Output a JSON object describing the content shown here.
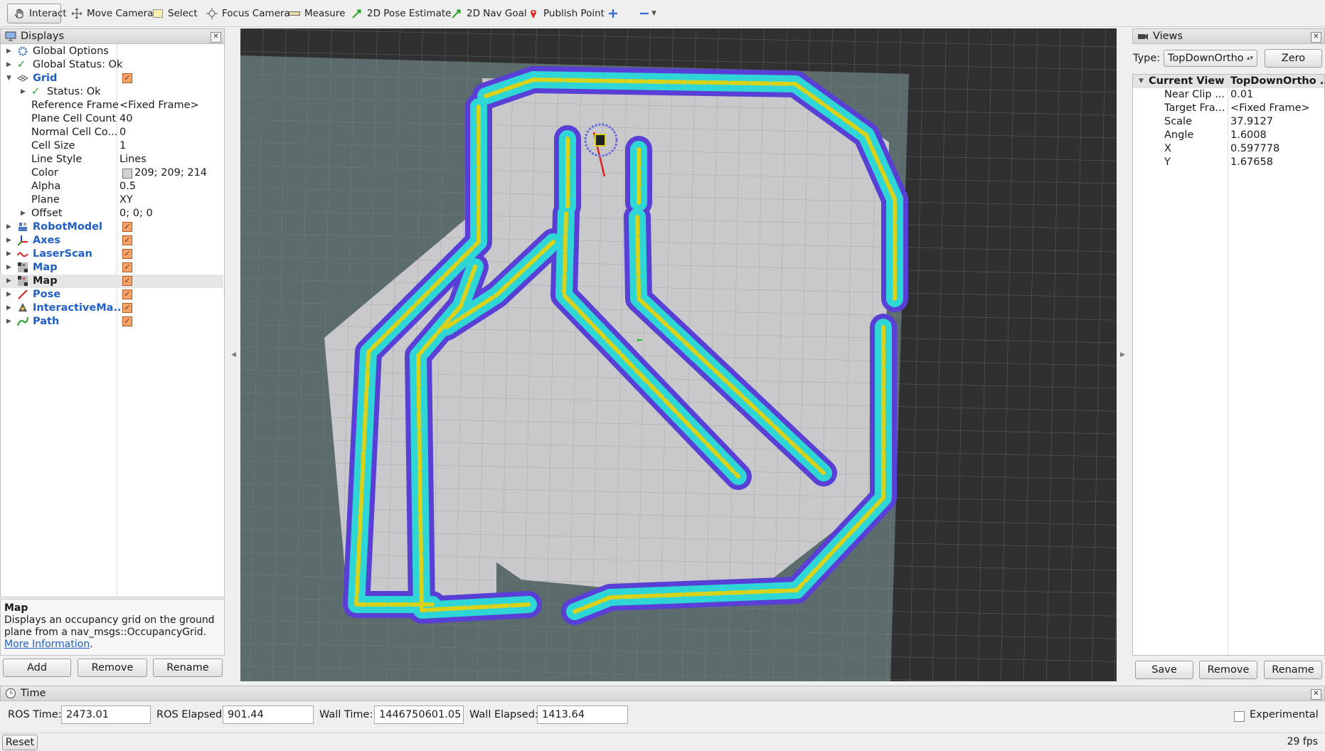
{
  "toolbar": {
    "interact": "Interact",
    "move_camera": "Move Camera",
    "select": "Select",
    "focus_camera": "Focus Camera",
    "measure": "Measure",
    "pose_estimate": "2D Pose Estimate",
    "nav_goal": "2D Nav Goal",
    "publish_point": "Publish Point"
  },
  "displays": {
    "title": "Displays",
    "rows": [
      {
        "name": "Global Options"
      },
      {
        "name": "Global Status: Ok"
      },
      {
        "name": "Grid"
      },
      {
        "name": "Status: Ok"
      },
      {
        "name": "Reference Frame",
        "value": "<Fixed Frame>"
      },
      {
        "name": "Plane Cell Count",
        "value": "40"
      },
      {
        "name": "Normal Cell Co...",
        "value": "0"
      },
      {
        "name": "Cell Size",
        "value": "1"
      },
      {
        "name": "Line Style",
        "value": "Lines"
      },
      {
        "name": "Color",
        "value": "209; 209; 214"
      },
      {
        "name": "Alpha",
        "value": "0.5"
      },
      {
        "name": "Plane",
        "value": "XY"
      },
      {
        "name": "Offset",
        "value": "0; 0; 0"
      },
      {
        "name": "RobotModel"
      },
      {
        "name": "Axes"
      },
      {
        "name": "LaserScan"
      },
      {
        "name": "Map"
      },
      {
        "name": "Map"
      },
      {
        "name": "Pose"
      },
      {
        "name": "InteractiveMa..."
      },
      {
        "name": "Path"
      }
    ],
    "desc_title": "Map",
    "desc_text": "Displays an occupancy grid on the ground plane from a nav_msgs::OccupancyGrid. ",
    "desc_link": "More Information",
    "desc_end": ".",
    "add": "Add",
    "remove": "Remove",
    "rename": "Rename"
  },
  "views": {
    "title": "Views",
    "type_label": "Type:",
    "type_value": "TopDownOrtho",
    "zero": "Zero",
    "header_name": "Current View",
    "header_value": "TopDownOrtho ...",
    "props": [
      {
        "name": "Near Clip ...",
        "value": "0.01"
      },
      {
        "name": "Target Fra...",
        "value": "<Fixed Frame>"
      },
      {
        "name": "Scale",
        "value": "37.9127"
      },
      {
        "name": "Angle",
        "value": "1.6008"
      },
      {
        "name": "X",
        "value": "0.597778"
      },
      {
        "name": "Y",
        "value": "1.67658"
      }
    ],
    "save": "Save",
    "remove": "Remove",
    "rename": "Rename"
  },
  "time": {
    "title": "Time",
    "ros_time_label": "ROS Time:",
    "ros_time": "2473.01",
    "ros_elapsed_label": "ROS Elapsed:",
    "ros_elapsed": "901.44",
    "wall_time_label": "Wall Time:",
    "wall_time": "1446750601.05",
    "wall_elapsed_label": "Wall Elapsed:",
    "wall_elapsed": "1413.64",
    "experimental": "Experimental"
  },
  "status": {
    "reset": "Reset",
    "fps": "29 fps"
  },
  "colors": {
    "accent_blue": "#1f5fc6",
    "checkbox": "#f5a46b",
    "map_cyan": "#2fd6d6",
    "map_purple": "#5a3fd6",
    "map_yellow": "#d9d21a"
  }
}
